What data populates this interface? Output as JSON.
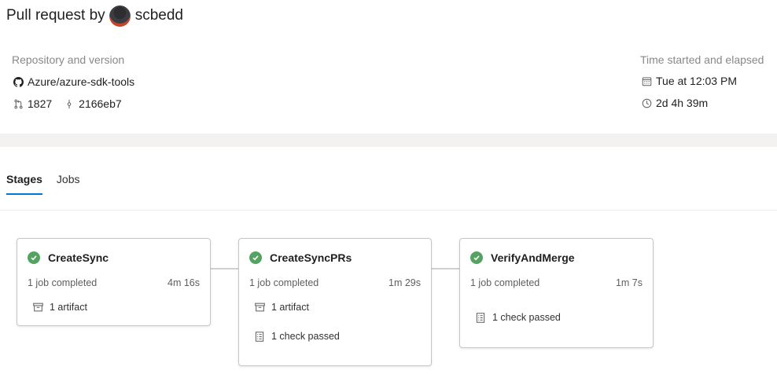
{
  "header": {
    "title_prefix": "Pull request by",
    "author": "scbedd"
  },
  "repository": {
    "heading": "Repository and version",
    "repo_name": "Azure/azure-sdk-tools",
    "pr_number": "1827",
    "commit": "2166eb7",
    "icons": [
      "github-icon",
      "pull-request-icon",
      "commit-icon"
    ]
  },
  "timing": {
    "heading": "Time started and elapsed",
    "started": "Tue at 12:03 PM",
    "elapsed": "2d 4h 39m",
    "icons": [
      "calendar-icon",
      "clock-icon"
    ]
  },
  "tabs": [
    {
      "label": "Stages",
      "active": true
    },
    {
      "label": "Jobs",
      "active": false
    }
  ],
  "stages": [
    {
      "name": "CreateSync",
      "status": "1 job completed",
      "duration": "4m 16s",
      "artifact": "1 artifact"
    },
    {
      "name": "CreateSyncPRs",
      "status": "1 job completed",
      "duration": "1m 29s",
      "artifact": "1 artifact",
      "checks": "1 check passed"
    },
    {
      "name": "VerifyAndMerge",
      "status": "1 job completed",
      "duration": "1m 7s",
      "checks": "1 check passed"
    }
  ],
  "colors": {
    "success": "#55a362",
    "accent": "#0078d4",
    "muted_text": "#8a8886"
  }
}
